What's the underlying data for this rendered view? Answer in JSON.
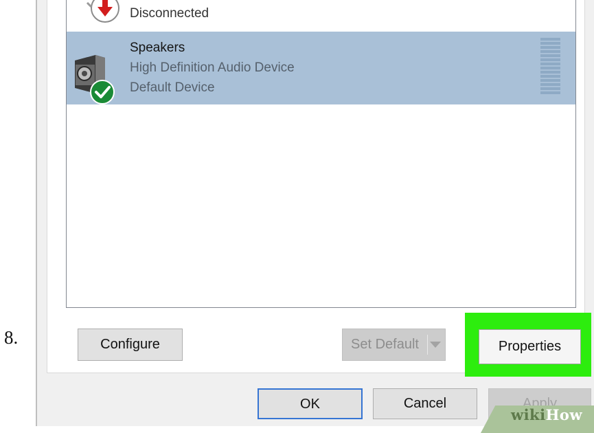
{
  "step": {
    "number": "8."
  },
  "devices": [
    {
      "name": "",
      "description": "Disconnected",
      "status": "",
      "icon": "disconnected-arrow-icon",
      "selected": false
    },
    {
      "name": "Speakers",
      "description": "High Definition Audio Device",
      "status": "Default Device",
      "icon": "speaker-icon",
      "badge_icon": "green-check-icon",
      "selected": true
    }
  ],
  "buttons": {
    "configure": "Configure",
    "set_default": "Set Default",
    "properties": "Properties",
    "ok": "OK",
    "cancel": "Cancel",
    "apply": "Apply"
  },
  "watermark": {
    "part1": "wiki",
    "part2": "How"
  },
  "colors": {
    "highlight": "#2ded0e",
    "selection": "#a9c0d7",
    "focus_border": "#3574d3",
    "check_badge": "#1a8a36",
    "disconnect_arrow": "#d21e1e"
  }
}
